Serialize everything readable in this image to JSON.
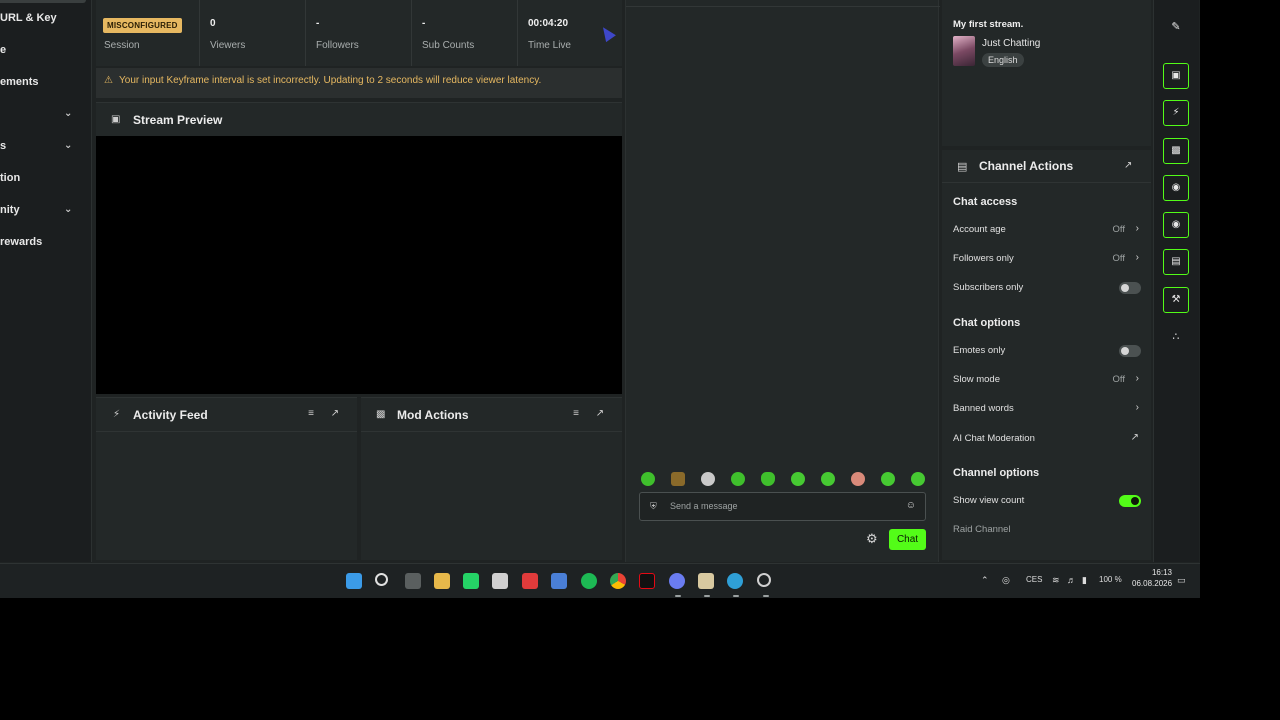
{
  "sidebar": {
    "items": [
      {
        "label": "URL & Key"
      },
      {
        "label": "e"
      },
      {
        "label": "ements"
      },
      {
        "label": ""
      },
      {
        "label": "s"
      },
      {
        "label": "tion"
      },
      {
        "label": "nity"
      },
      {
        "label": "rewards"
      }
    ]
  },
  "stats": {
    "status_badge": "MISCONFIGURED",
    "session_label": "Session",
    "viewers_value": "0",
    "viewers_label": "Viewers",
    "followers_value": "-",
    "followers_label": "Followers",
    "subs_value": "-",
    "subs_label": "Sub Counts",
    "time_value": "00:04:20",
    "time_label": "Time Live"
  },
  "warning": {
    "text": "Your input Keyframe interval is set incorrectly. Updating to 2 seconds will reduce viewer latency."
  },
  "panels": {
    "preview_title": "Stream Preview",
    "activity_title": "Activity Feed",
    "mod_title": "Mod Actions"
  },
  "chat": {
    "placeholder": "Send a message",
    "send_label": "Chat"
  },
  "stream_info": {
    "title": "My first stream.",
    "category": "Just Chatting",
    "language": "English"
  },
  "channel_actions": {
    "title": "Channel Actions",
    "chat_access_heading": "Chat access",
    "account_age_label": "Account age",
    "account_age_value": "Off",
    "followers_only_label": "Followers only",
    "followers_only_value": "Off",
    "subscribers_only_label": "Subscribers only",
    "chat_options_heading": "Chat options",
    "emotes_only_label": "Emotes only",
    "slow_mode_label": "Slow mode",
    "slow_mode_value": "Off",
    "banned_words_label": "Banned words",
    "ai_moderation_label": "AI Chat Moderation",
    "channel_options_heading": "Channel options",
    "show_view_count_label": "Show view count",
    "raid_channel_label": "Raid Channel"
  },
  "toggles": {
    "subscribers_only": false,
    "emotes_only": false,
    "show_view_count": true
  },
  "taskbar": {
    "lang": "CES",
    "battery": "100 %",
    "time": "16:13",
    "date": "06.08.2026"
  },
  "colors": {
    "accent": "#53fc18",
    "warning": "#e6b861",
    "panel": "#232828",
    "background": "#1f2323"
  }
}
